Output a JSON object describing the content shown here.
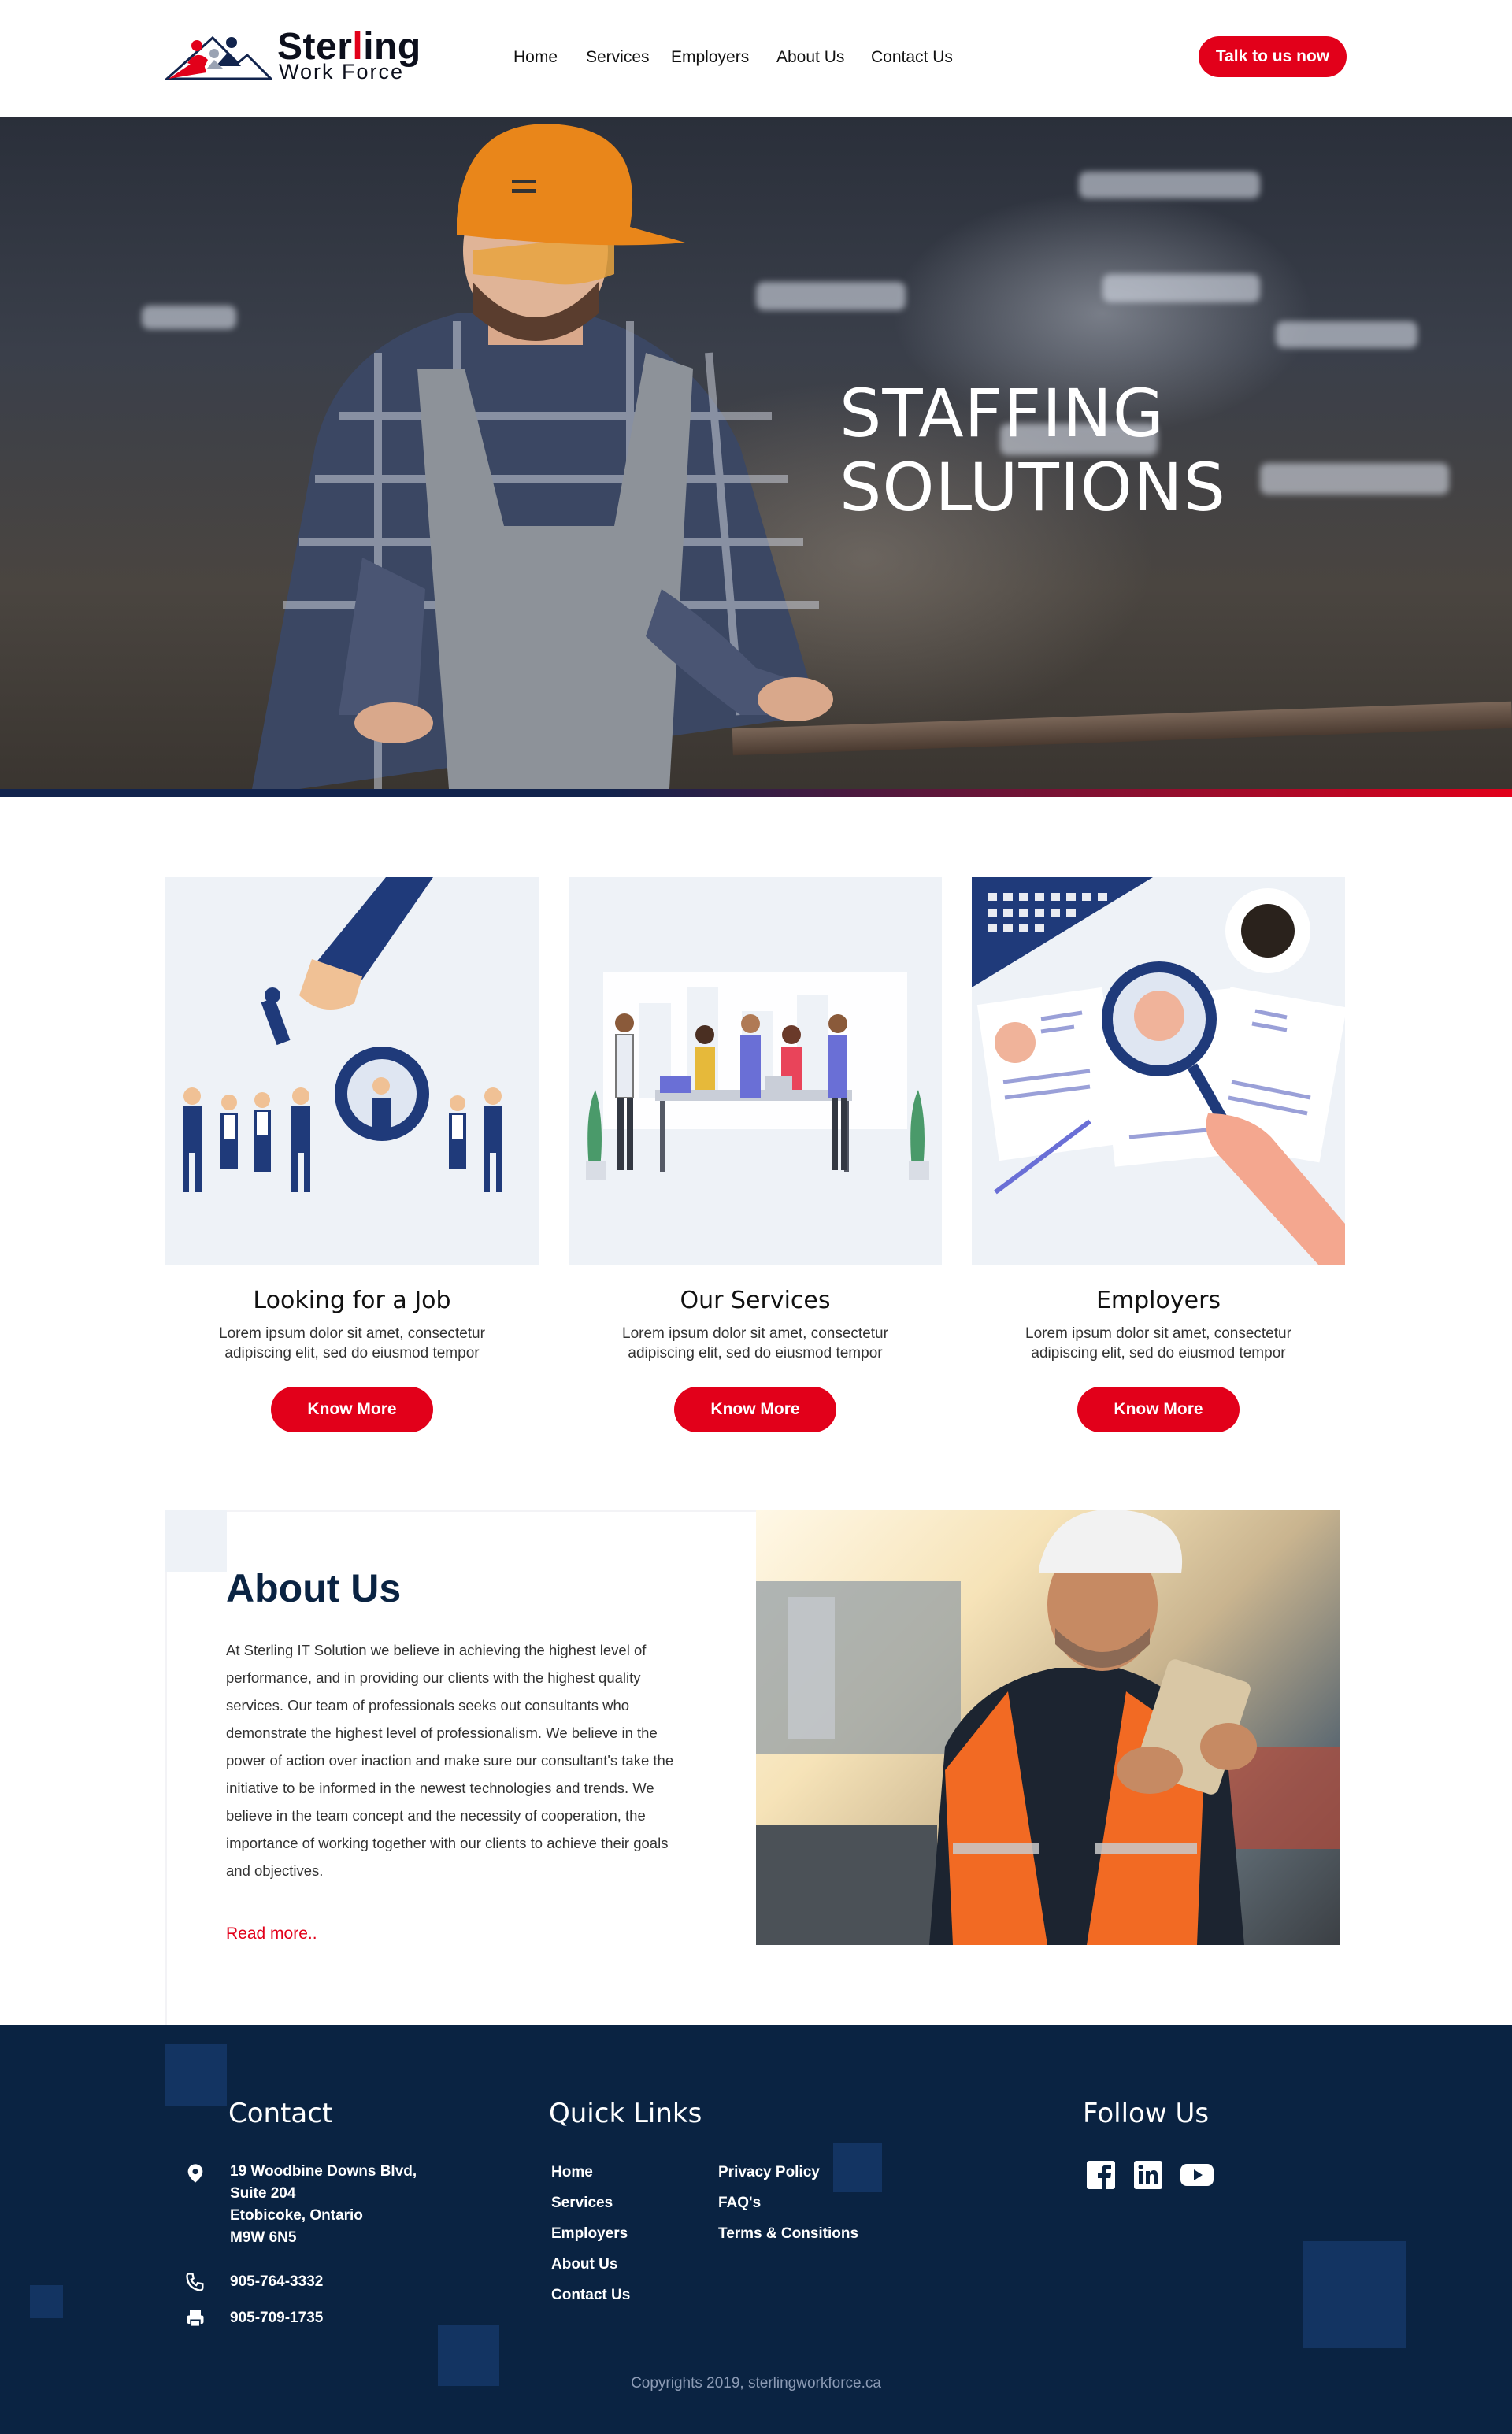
{
  "brand": {
    "name_part1": "Ster",
    "name_part2": "l",
    "name_part3": "ing",
    "tagline": "Work Force",
    "colors": {
      "primary_red": "#e2001a",
      "navy": "#0a2342",
      "light_panel": "#eef2f7"
    }
  },
  "nav": {
    "items": [
      "Home",
      "Services",
      "Employers",
      "About Us",
      "Contact Us"
    ],
    "cta_label": "Talk to us now"
  },
  "hero": {
    "title_line1": "STAFFING",
    "title_line2": "SOLUTIONS"
  },
  "cards": [
    {
      "title": "Looking for a Job",
      "desc_line1": "Lorem ipsum dolor sit amet, consectetur",
      "desc_line2": "adipiscing elit, sed do eiusmod tempor",
      "button": "Know More"
    },
    {
      "title": "Our Services",
      "desc_line1": "Lorem ipsum dolor sit amet, consectetur",
      "desc_line2": "adipiscing elit, sed do eiusmod tempor",
      "button": "Know More"
    },
    {
      "title": "Employers",
      "desc_line1": "Lorem ipsum dolor sit amet, consectetur",
      "desc_line2": "adipiscing elit, sed do eiusmod tempor",
      "button": "Know More"
    }
  ],
  "about": {
    "title": "About Us",
    "body": "At Sterling IT Solution we believe in achieving the highest level of performance, and in providing our clients with the highest quality services. Our team of professionals seeks out consultants who demonstrate the highest level of professionalism. We believe in the power of action over inaction and make sure our consultant's take the initiative to be informed in the newest technologies and trends. We believe in the team concept and the necessity of cooperation, the importance of working together with our clients to achieve their goals and objectives.",
    "read_more": "Read more.."
  },
  "footer": {
    "contact": {
      "heading": "Contact",
      "address_lines": [
        "19 Woodbine Downs Blvd,",
        "Suite 204",
        "Etobicoke, Ontario",
        "M9W 6N5"
      ],
      "phone": "905-764-3332",
      "fax": "905-709-1735"
    },
    "quick_links": {
      "heading": "Quick Links",
      "col1": [
        "Home",
        "Services",
        "Employers",
        "About Us",
        "Contact Us"
      ],
      "col2": [
        "Privacy Policy",
        "FAQ's",
        "Terms & Consitions"
      ]
    },
    "follow": {
      "heading": "Follow Us",
      "icons": [
        "facebook-icon",
        "linkedin-icon",
        "youtube-icon"
      ]
    },
    "copyright": "Copyrights 2019, sterlingworkforce.ca"
  }
}
